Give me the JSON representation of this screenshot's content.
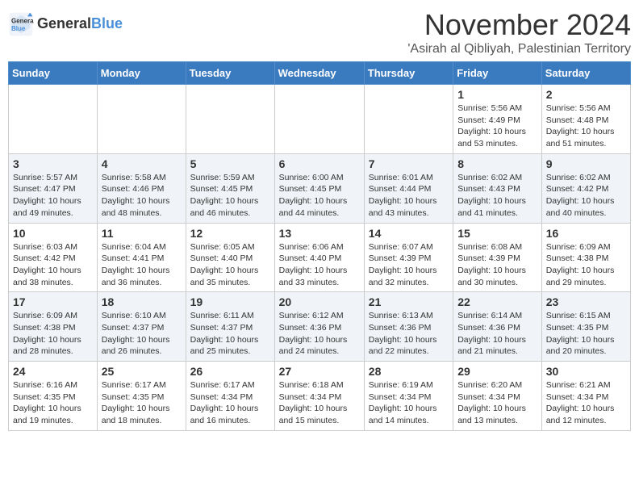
{
  "header": {
    "logo_line1": "General",
    "logo_line2": "Blue",
    "month": "November 2024",
    "location": "'Asirah al Qibliyah, Palestinian Territory"
  },
  "weekdays": [
    "Sunday",
    "Monday",
    "Tuesday",
    "Wednesday",
    "Thursday",
    "Friday",
    "Saturday"
  ],
  "weeks": [
    [
      null,
      null,
      null,
      null,
      null,
      {
        "day": "1",
        "sunrise": "Sunrise: 5:56 AM",
        "sunset": "Sunset: 4:49 PM",
        "daylight": "Daylight: 10 hours and 53 minutes."
      },
      {
        "day": "2",
        "sunrise": "Sunrise: 5:56 AM",
        "sunset": "Sunset: 4:48 PM",
        "daylight": "Daylight: 10 hours and 51 minutes."
      }
    ],
    [
      {
        "day": "3",
        "sunrise": "Sunrise: 5:57 AM",
        "sunset": "Sunset: 4:47 PM",
        "daylight": "Daylight: 10 hours and 49 minutes."
      },
      {
        "day": "4",
        "sunrise": "Sunrise: 5:58 AM",
        "sunset": "Sunset: 4:46 PM",
        "daylight": "Daylight: 10 hours and 48 minutes."
      },
      {
        "day": "5",
        "sunrise": "Sunrise: 5:59 AM",
        "sunset": "Sunset: 4:45 PM",
        "daylight": "Daylight: 10 hours and 46 minutes."
      },
      {
        "day": "6",
        "sunrise": "Sunrise: 6:00 AM",
        "sunset": "Sunset: 4:45 PM",
        "daylight": "Daylight: 10 hours and 44 minutes."
      },
      {
        "day": "7",
        "sunrise": "Sunrise: 6:01 AM",
        "sunset": "Sunset: 4:44 PM",
        "daylight": "Daylight: 10 hours and 43 minutes."
      },
      {
        "day": "8",
        "sunrise": "Sunrise: 6:02 AM",
        "sunset": "Sunset: 4:43 PM",
        "daylight": "Daylight: 10 hours and 41 minutes."
      },
      {
        "day": "9",
        "sunrise": "Sunrise: 6:02 AM",
        "sunset": "Sunset: 4:42 PM",
        "daylight": "Daylight: 10 hours and 40 minutes."
      }
    ],
    [
      {
        "day": "10",
        "sunrise": "Sunrise: 6:03 AM",
        "sunset": "Sunset: 4:42 PM",
        "daylight": "Daylight: 10 hours and 38 minutes."
      },
      {
        "day": "11",
        "sunrise": "Sunrise: 6:04 AM",
        "sunset": "Sunset: 4:41 PM",
        "daylight": "Daylight: 10 hours and 36 minutes."
      },
      {
        "day": "12",
        "sunrise": "Sunrise: 6:05 AM",
        "sunset": "Sunset: 4:40 PM",
        "daylight": "Daylight: 10 hours and 35 minutes."
      },
      {
        "day": "13",
        "sunrise": "Sunrise: 6:06 AM",
        "sunset": "Sunset: 4:40 PM",
        "daylight": "Daylight: 10 hours and 33 minutes."
      },
      {
        "day": "14",
        "sunrise": "Sunrise: 6:07 AM",
        "sunset": "Sunset: 4:39 PM",
        "daylight": "Daylight: 10 hours and 32 minutes."
      },
      {
        "day": "15",
        "sunrise": "Sunrise: 6:08 AM",
        "sunset": "Sunset: 4:39 PM",
        "daylight": "Daylight: 10 hours and 30 minutes."
      },
      {
        "day": "16",
        "sunrise": "Sunrise: 6:09 AM",
        "sunset": "Sunset: 4:38 PM",
        "daylight": "Daylight: 10 hours and 29 minutes."
      }
    ],
    [
      {
        "day": "17",
        "sunrise": "Sunrise: 6:09 AM",
        "sunset": "Sunset: 4:38 PM",
        "daylight": "Daylight: 10 hours and 28 minutes."
      },
      {
        "day": "18",
        "sunrise": "Sunrise: 6:10 AM",
        "sunset": "Sunset: 4:37 PM",
        "daylight": "Daylight: 10 hours and 26 minutes."
      },
      {
        "day": "19",
        "sunrise": "Sunrise: 6:11 AM",
        "sunset": "Sunset: 4:37 PM",
        "daylight": "Daylight: 10 hours and 25 minutes."
      },
      {
        "day": "20",
        "sunrise": "Sunrise: 6:12 AM",
        "sunset": "Sunset: 4:36 PM",
        "daylight": "Daylight: 10 hours and 24 minutes."
      },
      {
        "day": "21",
        "sunrise": "Sunrise: 6:13 AM",
        "sunset": "Sunset: 4:36 PM",
        "daylight": "Daylight: 10 hours and 22 minutes."
      },
      {
        "day": "22",
        "sunrise": "Sunrise: 6:14 AM",
        "sunset": "Sunset: 4:36 PM",
        "daylight": "Daylight: 10 hours and 21 minutes."
      },
      {
        "day": "23",
        "sunrise": "Sunrise: 6:15 AM",
        "sunset": "Sunset: 4:35 PM",
        "daylight": "Daylight: 10 hours and 20 minutes."
      }
    ],
    [
      {
        "day": "24",
        "sunrise": "Sunrise: 6:16 AM",
        "sunset": "Sunset: 4:35 PM",
        "daylight": "Daylight: 10 hours and 19 minutes."
      },
      {
        "day": "25",
        "sunrise": "Sunrise: 6:17 AM",
        "sunset": "Sunset: 4:35 PM",
        "daylight": "Daylight: 10 hours and 18 minutes."
      },
      {
        "day": "26",
        "sunrise": "Sunrise: 6:17 AM",
        "sunset": "Sunset: 4:34 PM",
        "daylight": "Daylight: 10 hours and 16 minutes."
      },
      {
        "day": "27",
        "sunrise": "Sunrise: 6:18 AM",
        "sunset": "Sunset: 4:34 PM",
        "daylight": "Daylight: 10 hours and 15 minutes."
      },
      {
        "day": "28",
        "sunrise": "Sunrise: 6:19 AM",
        "sunset": "Sunset: 4:34 PM",
        "daylight": "Daylight: 10 hours and 14 minutes."
      },
      {
        "day": "29",
        "sunrise": "Sunrise: 6:20 AM",
        "sunset": "Sunset: 4:34 PM",
        "daylight": "Daylight: 10 hours and 13 minutes."
      },
      {
        "day": "30",
        "sunrise": "Sunrise: 6:21 AM",
        "sunset": "Sunset: 4:34 PM",
        "daylight": "Daylight: 10 hours and 12 minutes."
      }
    ]
  ]
}
